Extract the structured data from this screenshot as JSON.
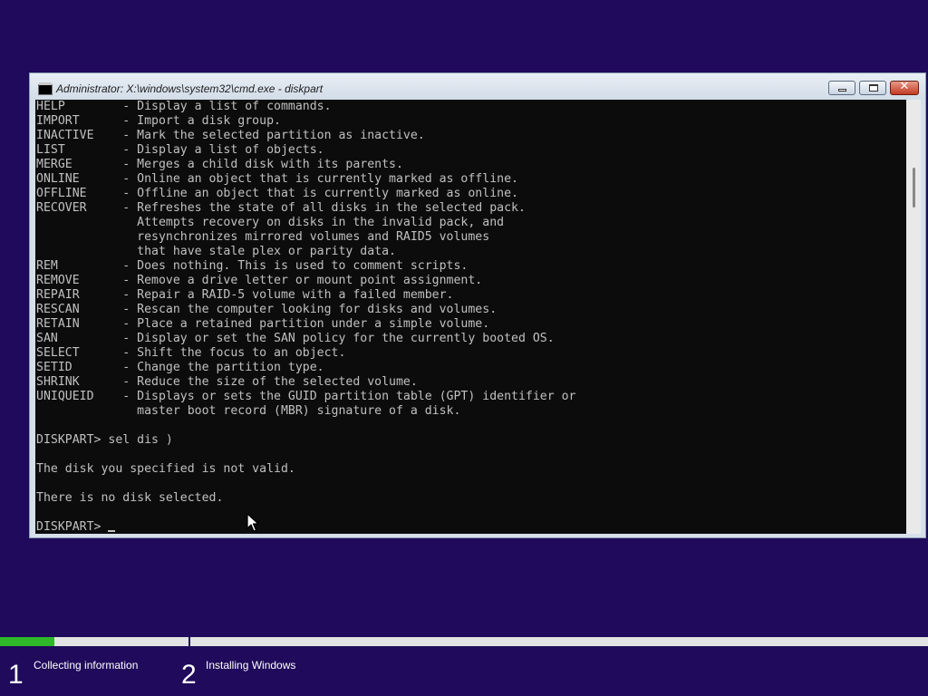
{
  "window": {
    "title": "Administrator: X:\\windows\\system32\\cmd.exe - diskpart",
    "icons": {
      "app": "console-icon",
      "minimize": "minimize-icon",
      "maximize": "maximize-icon",
      "close": "close-icon"
    },
    "close_glyph": "✕"
  },
  "console": {
    "lines": [
      "HELP        - Display a list of commands.",
      "IMPORT      - Import a disk group.",
      "INACTIVE    - Mark the selected partition as inactive.",
      "LIST        - Display a list of objects.",
      "MERGE       - Merges a child disk with its parents.",
      "ONLINE      - Online an object that is currently marked as offline.",
      "OFFLINE     - Offline an object that is currently marked as online.",
      "RECOVER     - Refreshes the state of all disks in the selected pack.",
      "              Attempts recovery on disks in the invalid pack, and",
      "              resynchronizes mirrored volumes and RAID5 volumes",
      "              that have stale plex or parity data.",
      "REM         - Does nothing. This is used to comment scripts.",
      "REMOVE      - Remove a drive letter or mount point assignment.",
      "REPAIR      - Repair a RAID-5 volume with a failed member.",
      "RESCAN      - Rescan the computer looking for disks and volumes.",
      "RETAIN      - Place a retained partition under a simple volume.",
      "SAN         - Display or set the SAN policy for the currently booted OS.",
      "SELECT      - Shift the focus to an object.",
      "SETID       - Change the partition type.",
      "SHRINK      - Reduce the size of the selected volume.",
      "UNIQUEID    - Displays or sets the GUID partition table (GPT) identifier or",
      "              master boot record (MBR) signature of a disk.",
      "",
      "DISKPART> sel dis )",
      "",
      "The disk you specified is not valid.",
      "",
      "There is no disk selected.",
      ""
    ],
    "prompt": "DISKPART>"
  },
  "setup": {
    "progress_percent": 29,
    "steps": [
      {
        "number": "1",
        "label": "Collecting information"
      },
      {
        "number": "2",
        "label": "Installing Windows"
      }
    ]
  },
  "colors": {
    "background": "#1f0a5b",
    "progress": "#2fb82a",
    "console_bg": "#0c0c0c",
    "console_fg": "#c0c0c0"
  }
}
